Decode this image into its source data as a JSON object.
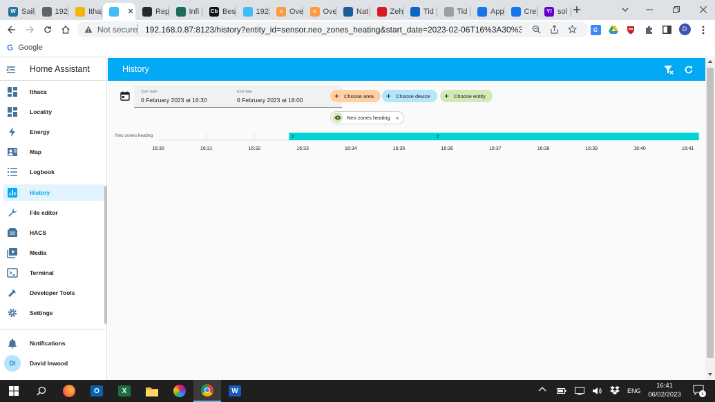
{
  "browser": {
    "tabs": [
      {
        "label": "Sail",
        "icon": "wordpress-icon",
        "color": "#21759b",
        "glyph": "W"
      },
      {
        "label": "192",
        "icon": "globe-icon",
        "color": "#5f6368",
        "glyph": ""
      },
      {
        "label": "Itha",
        "icon": "pinwheel-icon",
        "color": "#f4b400",
        "glyph": ""
      },
      {
        "label": "",
        "icon": "home-assistant-icon",
        "color": "#41bdf5",
        "glyph": ""
      },
      {
        "label": "Rep",
        "icon": "github-icon",
        "color": "#24292e",
        "glyph": ""
      },
      {
        "label": "Infi",
        "icon": "infi-icon",
        "color": "#1e6b5a",
        "glyph": ""
      },
      {
        "label": "Bes",
        "icon": "cb-icon",
        "color": "#111111",
        "glyph": "Cb"
      },
      {
        "label": "192",
        "icon": "wave-icon",
        "color": "#41bdf5",
        "glyph": ""
      },
      {
        "label": "Ove",
        "icon": "link-icon",
        "color": "#ff9a3c",
        "glyph": "o"
      },
      {
        "label": "Ove",
        "icon": "link-icon",
        "color": "#ff9a3c",
        "glyph": "o"
      },
      {
        "label": "Nat",
        "icon": "nat-icon",
        "color": "#1b5e9e",
        "glyph": ""
      },
      {
        "label": "Zeh",
        "icon": "zeh-icon",
        "color": "#d71920",
        "glyph": ""
      },
      {
        "label": "Tid",
        "icon": "tid-icon",
        "color": "#0a66c2",
        "glyph": ""
      },
      {
        "label": "Tid",
        "icon": "tid2-icon",
        "color": "#9e9e9e",
        "glyph": ""
      },
      {
        "label": "App",
        "icon": "wave2-icon",
        "color": "#1a73e8",
        "glyph": ""
      },
      {
        "label": "Cre",
        "icon": "wave2-icon",
        "color": "#1a73e8",
        "glyph": ""
      },
      {
        "label": "sol",
        "icon": "yahoo-icon",
        "color": "#6001d2",
        "glyph": "Y!"
      }
    ],
    "url": "192.168.0.87:8123/history?entity_id=sensor.neo_zones_heating&start_date=2023-02-06T16%3A30%3A00.00...",
    "security_label": "Not secure",
    "bookmark": "Google",
    "profile_initial": "D"
  },
  "sidebar": {
    "title": "Home Assistant",
    "items": [
      {
        "label": "Ithaca",
        "icon": "dashboard-icon"
      },
      {
        "label": "Locality",
        "icon": "dashboard-icon"
      },
      {
        "label": "Energy",
        "icon": "lightning-icon"
      },
      {
        "label": "Map",
        "icon": "map-icon"
      },
      {
        "label": "Logbook",
        "icon": "list-icon"
      },
      {
        "label": "History",
        "icon": "chart-icon"
      },
      {
        "label": "File editor",
        "icon": "wrench-icon"
      },
      {
        "label": "HACS",
        "icon": "hacs-icon"
      },
      {
        "label": "Media",
        "icon": "media-icon"
      },
      {
        "label": "Terminal",
        "icon": "terminal-icon"
      },
      {
        "label": "Developer Tools",
        "icon": "hammer-icon"
      },
      {
        "label": "Settings",
        "icon": "gear-icon"
      }
    ],
    "notifications": "Notifications",
    "user": {
      "initials": "DI",
      "name": "David Inwood"
    }
  },
  "header": {
    "title": "History"
  },
  "filters": {
    "start_label": "Start date",
    "start_value": "6 February 2023 at 16:30",
    "end_label": "End date",
    "end_value": "6 February 2023 at 18:00",
    "choose_area": "Choose area",
    "choose_device": "Choose device",
    "choose_entity": "Choose entity",
    "entity_chip": "Neo zones heating"
  },
  "colors": {
    "primary": "#03a9f4",
    "timeline": "#00d4d4",
    "area_chip": "#ffd0a3",
    "device_chip": "#b3e5fc",
    "entity_chip": "#d4e8b8"
  },
  "chart_data": {
    "type": "timeline",
    "entity": "Neo zones heating",
    "x_ticks": [
      "16:30",
      "16:31",
      "16:32",
      "16:33",
      "16:34",
      "16:35",
      "16:36",
      "16:37",
      "16:38",
      "16:39",
      "16:40",
      "16:41"
    ],
    "segments": [
      {
        "start": "16:32:43",
        "end": "16:41",
        "state": "2",
        "labels": [
          "2",
          "2"
        ]
      }
    ]
  },
  "taskbar": {
    "apps": [
      "windows-icon",
      "search-icon",
      "firefox-icon",
      "outlook-icon",
      "excel-icon",
      "file-explorer-icon",
      "photos-icon",
      "chrome-icon",
      "word-icon"
    ],
    "language": "ENG",
    "time": "16:41",
    "date": "06/02/2023",
    "notification_count": "1"
  }
}
